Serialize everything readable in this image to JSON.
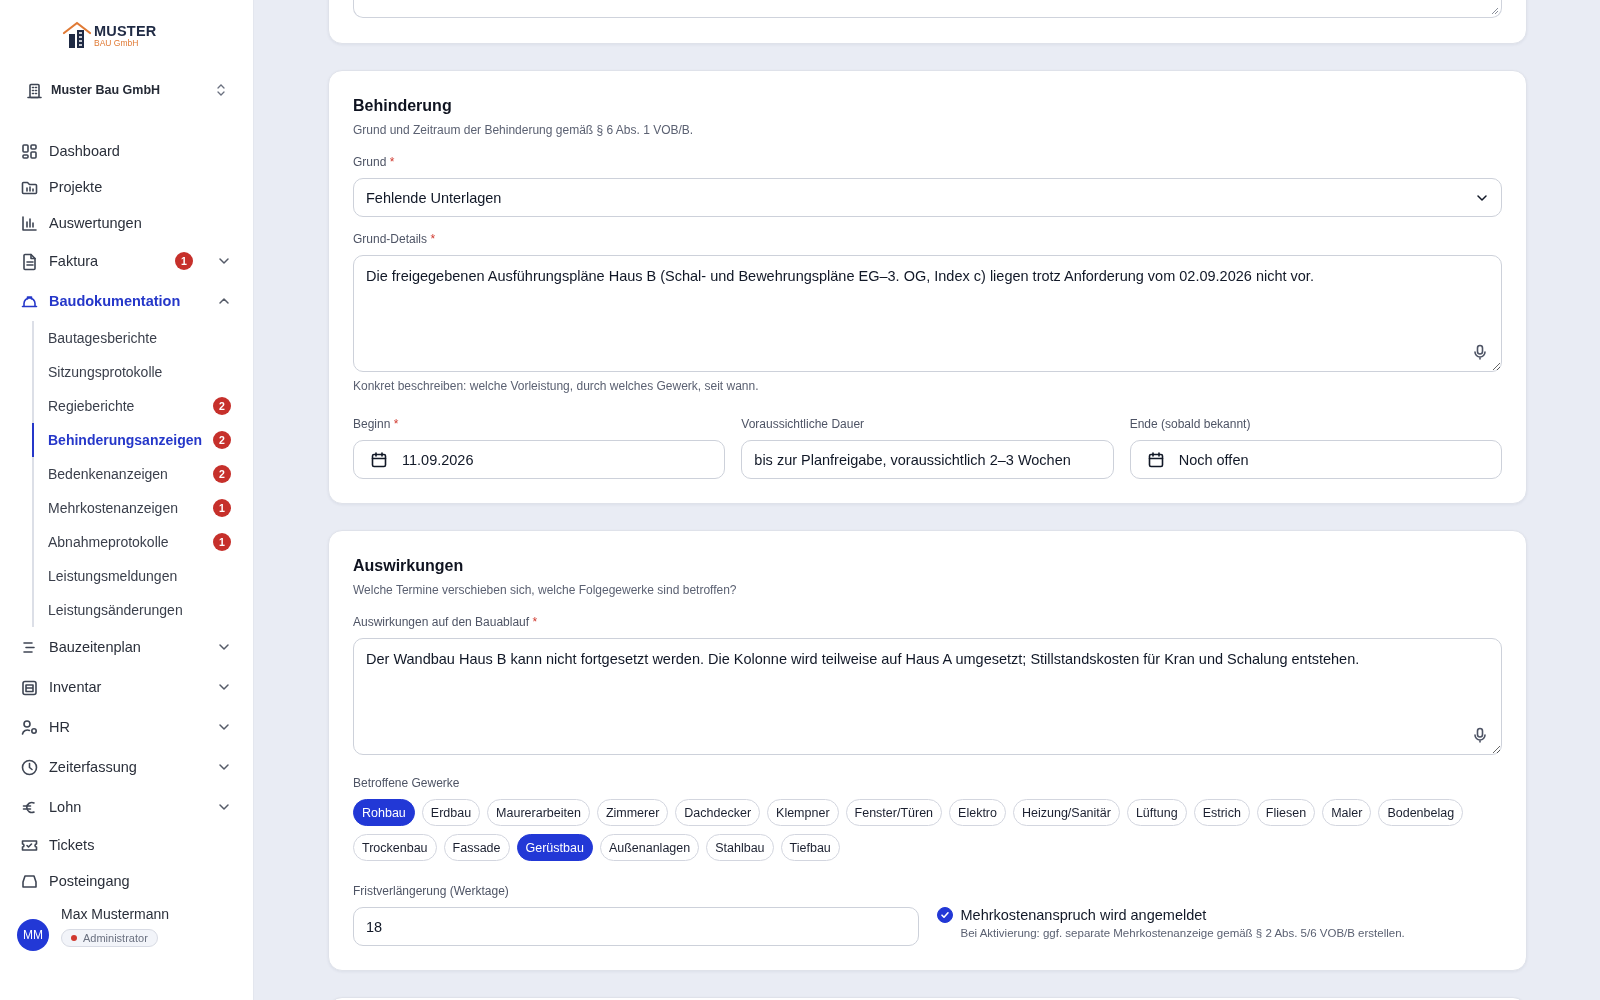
{
  "sidebar": {
    "logo": {
      "title": "MUSTER",
      "subtitle": "BAU GmbH"
    },
    "company_switcher": {
      "label": "Muster Bau GmbH"
    },
    "nav": [
      {
        "label": "Dashboard",
        "selected": false
      },
      {
        "label": "Projekte",
        "selected": false
      },
      {
        "label": "Auswertungen",
        "selected": false
      },
      {
        "label": "Faktura",
        "selected": false,
        "badge": "1",
        "expanded": false
      },
      {
        "label": "Baudokumentation",
        "selected": true,
        "expanded": true,
        "children": [
          {
            "label": "Bautagesberichte",
            "selected": false
          },
          {
            "label": "Sitzungsprotokolle",
            "selected": false
          },
          {
            "label": "Regieberichte",
            "selected": false,
            "badge": "2"
          },
          {
            "label": "Behinderungsanzeigen",
            "selected": true,
            "badge": "2"
          },
          {
            "label": "Bedenkenanzeigen",
            "selected": false,
            "badge": "2"
          },
          {
            "label": "Mehrkostenanzeigen",
            "selected": false,
            "badge": "1"
          },
          {
            "label": "Abnahmeprotokolle",
            "selected": false,
            "badge": "1"
          },
          {
            "label": "Leistungsmeldungen",
            "selected": false
          },
          {
            "label": "Leistungsänderungen",
            "selected": false
          }
        ]
      },
      {
        "label": "Bauzeitenplan",
        "selected": false,
        "expanded": false
      },
      {
        "label": "Inventar",
        "selected": false,
        "expanded": false
      },
      {
        "label": "HR",
        "selected": false,
        "expanded": false
      },
      {
        "label": "Zeiterfassung",
        "selected": false,
        "expanded": false
      },
      {
        "label": "Lohn",
        "selected": false,
        "expanded": false
      },
      {
        "label": "Tickets",
        "selected": false
      },
      {
        "label": "Posteingang",
        "selected": false
      }
    ],
    "user": {
      "initials": "MM",
      "name": "Max Mustermann",
      "role": "Administrator"
    }
  },
  "sections": [
    {
      "title": "Behinderung",
      "subtitle": "Grund und Zeitraum der Behinderung gemäß § 6 Abs. 1 VOB/B.",
      "fields": [
        {
          "kind": "select",
          "label": "Grund",
          "required_mark": "*",
          "value": "Fehlende Unterlagen"
        },
        {
          "kind": "textarea",
          "label": "Grund-Details",
          "required_mark": "*",
          "value": "Die freigegebenen Ausführungspläne Haus B (Schal- und Bewehrungspläne EG–3. OG, Index c) liegen trotz Anforderung vom 02.09.2026 nicht vor.",
          "hint": "Konkret beschreiben: welche Vorleistung, durch welches Gewerk, seit wann."
        },
        {
          "kind": "row",
          "fields": [
            {
              "kind": "date",
              "label": "Beginn",
              "required_mark": "*",
              "value": "11.09.2026"
            },
            {
              "kind": "text",
              "label": "Voraussichtliche Dauer",
              "value": "bis zur Planfreigabe, voraussichtlich 2–3 Wochen"
            },
            {
              "kind": "date",
              "label": "Ende (sobald bekannt)",
              "value": "Noch offen"
            }
          ]
        }
      ]
    },
    {
      "title": "Auswirkungen",
      "subtitle": "Welche Termine verschieben sich, welche Folgegewerke sind betroffen?",
      "fields": [
        {
          "kind": "textarea",
          "label": "Auswirkungen auf den Bauablauf",
          "required_mark": "*",
          "value": "Der Wandbau Haus B kann nicht fortgesetzt werden. Die Kolonne wird teilweise auf Haus A umgesetzt; Stillstandskosten für Kran und Schalung entstehen."
        },
        {
          "kind": "chips",
          "label": "Betroffene Gewerke",
          "options": [
            {
              "label": "Rohbau",
              "selected": true
            },
            {
              "label": "Erdbau",
              "selected": false
            },
            {
              "label": "Maurerarbeiten",
              "selected": false
            },
            {
              "label": "Zimmerer",
              "selected": false
            },
            {
              "label": "Dachdecker",
              "selected": false
            },
            {
              "label": "Klempner",
              "selected": false
            },
            {
              "label": "Fenster/Türen",
              "selected": false
            },
            {
              "label": "Elektro",
              "selected": false
            },
            {
              "label": "Heizung/Sanitär",
              "selected": false
            },
            {
              "label": "Lüftung",
              "selected": false
            },
            {
              "label": "Estrich",
              "selected": false
            },
            {
              "label": "Fliesen",
              "selected": false
            },
            {
              "label": "Maler",
              "selected": false
            },
            {
              "label": "Bodenbelag",
              "selected": false
            },
            {
              "label": "Trockenbau",
              "selected": false
            },
            {
              "label": "Fassade",
              "selected": false
            },
            {
              "label": "Gerüstbau",
              "selected": true
            },
            {
              "label": "Außenanlagen",
              "selected": false
            },
            {
              "label": "Stahlbau",
              "selected": false
            },
            {
              "label": "Tiefbau",
              "selected": false
            }
          ]
        },
        {
          "kind": "split",
          "fields": [
            {
              "kind": "text",
              "label": "Fristverlängerung (Werktage)",
              "value": "18"
            },
            {
              "kind": "checkbox",
              "label": "Mehrkostenanspruch wird angemeldet",
              "checked": true,
              "hint": "Bei Aktivierung: ggf. separate Mehrkostenanzeige gemäß § 2 Abs. 5/6 VOB/B erstellen."
            }
          ]
        }
      ]
    }
  ]
}
